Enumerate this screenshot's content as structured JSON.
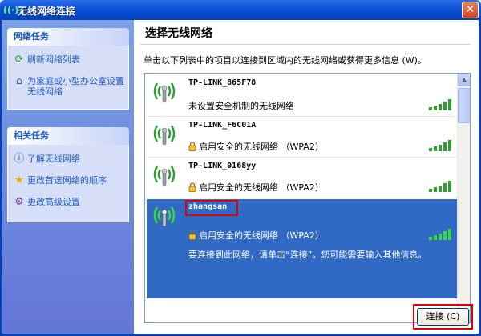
{
  "window": {
    "title": "无线网络连接",
    "close_label": "✕"
  },
  "sidebar": {
    "network_tasks": {
      "header": "网络任务",
      "items": [
        {
          "label": "刷新网络列表",
          "icon": "refresh-icon"
        },
        {
          "label": "为家庭或小型办公室设置无线网络",
          "icon": "setup-icon"
        }
      ]
    },
    "related_tasks": {
      "header": "相关任务",
      "items": [
        {
          "label": "了解无线网络",
          "icon": "info-icon"
        },
        {
          "label": "更改首选网络的顺序",
          "icon": "star-icon"
        },
        {
          "label": "更改高级设置",
          "icon": "settings-icon"
        }
      ]
    }
  },
  "main": {
    "heading": "选择无线网络",
    "instruction": "单击以下列表中的项目以连接到区域内的无线网络或获得更多信息 (W)。",
    "networks": [
      {
        "name": "TP-LINK_865F78",
        "security": "未设置安全机制的无线网络",
        "secured": false,
        "signal_bars": 5
      },
      {
        "name": "TP-LINK_F6C01A",
        "security": "启用安全的无线网络 （WPA2）",
        "secured": true,
        "signal_bars": 5
      },
      {
        "name": "TP-LINK_0168yy",
        "security": "启用安全的无线网络 （WPA2）",
        "secured": true,
        "signal_bars": 5
      },
      {
        "name": "zhangsan",
        "security": "启用安全的无线网络 （WPA2）",
        "secured": true,
        "signal_bars": 5,
        "selected": true,
        "message": "要连接到此网络，请单击“连接”。您可能需要输入其他信息。"
      }
    ],
    "connect_button": "连接 (C)"
  },
  "colors": {
    "accent": "#316ac5",
    "highlight_border": "#e00000",
    "title_bar": "#0a4fd6"
  }
}
